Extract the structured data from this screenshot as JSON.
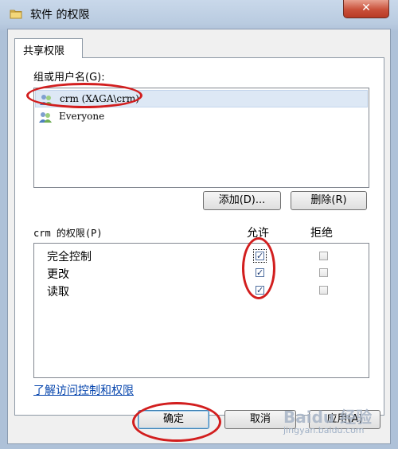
{
  "window": {
    "title": "软件 的权限",
    "close_glyph": "✕"
  },
  "tabs": [
    {
      "label": "共享权限",
      "active": true
    }
  ],
  "groups": {
    "label": "组或用户名(G):",
    "items": [
      {
        "name": "crm (XAGA\\crm)",
        "icon": "user-group-icon",
        "selected": true
      },
      {
        "name": "Everyone",
        "icon": "user-group-icon",
        "selected": false
      }
    ],
    "add_label": "添加(D)...",
    "remove_label": "删除(R)"
  },
  "permissions": {
    "label": "crm 的权限(P)",
    "allow_header": "允许",
    "deny_header": "拒绝",
    "rows": [
      {
        "name": "完全控制",
        "allow": true,
        "deny": false
      },
      {
        "name": "更改",
        "allow": true,
        "deny": false
      },
      {
        "name": "读取",
        "allow": true,
        "deny": false
      }
    ]
  },
  "help_link": "了解访问控制和权限",
  "buttons": {
    "ok": "确定",
    "cancel": "取消",
    "apply": "应用(A)"
  },
  "colors": {
    "annotation": "#d21e1e",
    "link": "#0645ad"
  },
  "watermark": {
    "brand": "Baidu 经验",
    "sub": "jingyan.baidu.com"
  }
}
